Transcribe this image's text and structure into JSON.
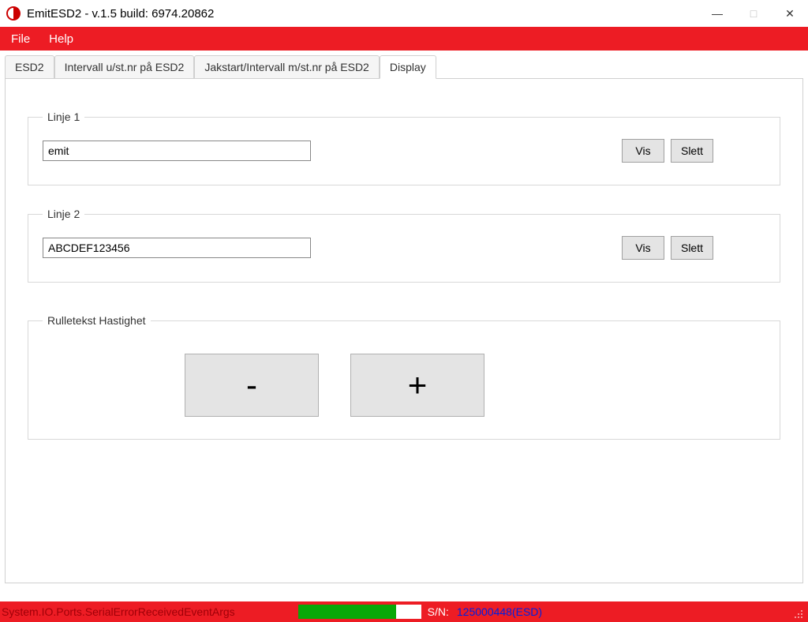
{
  "window": {
    "title": "EmitESD2  - v.1.5   build: 6974.20862",
    "minimize": "—",
    "maximize": "□",
    "close": "✕"
  },
  "menu": {
    "file": "File",
    "help": "Help"
  },
  "tabs": {
    "esd2": "ESD2",
    "interval_no_stnr": "Intervall u/st.nr på ESD2",
    "jakstart": "Jakstart/Intervall m/st.nr på ESD2",
    "display": "Display"
  },
  "display": {
    "line1": {
      "legend": "Linje 1",
      "value": "emit",
      "vis": "Vis",
      "slett": "Slett"
    },
    "line2": {
      "legend": "Linje 2",
      "value": "ABCDEF123456",
      "vis": "Vis",
      "slett": "Slett"
    },
    "speed": {
      "legend": "Rulletekst Hastighet",
      "minus": "-",
      "plus": "+"
    }
  },
  "status": {
    "left": "System.IO.Ports.SerialErrorReceivedEventArgs",
    "progress_percent": 80,
    "sn_label": "S/N:",
    "sn_value": "125000448(ESD)"
  }
}
